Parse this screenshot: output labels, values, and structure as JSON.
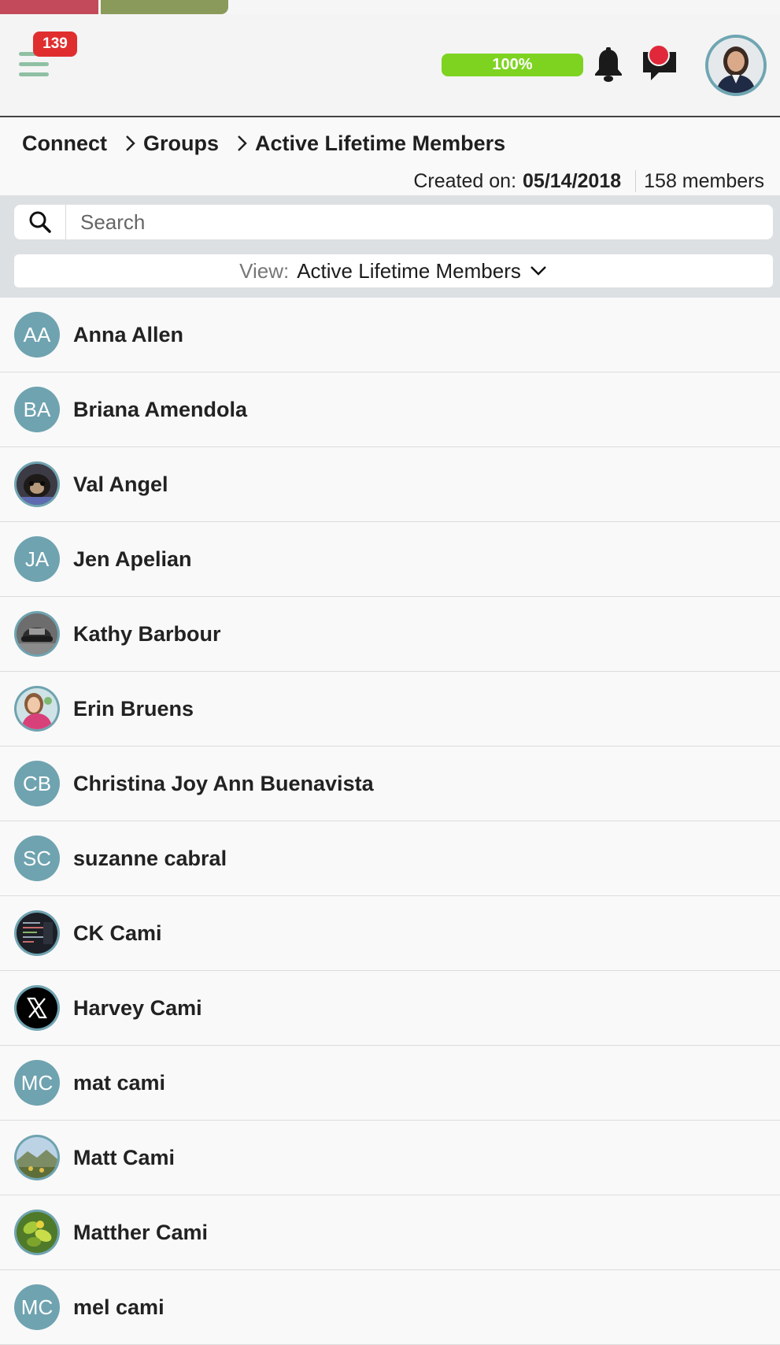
{
  "header": {
    "notification_count": "139",
    "progress_percent": 100,
    "progress_label": "100%"
  },
  "breadcrumb": {
    "items": [
      "Connect",
      "Groups",
      "Active Lifetime Members"
    ]
  },
  "group": {
    "created_label": "Created on:",
    "created_date": "05/14/2018",
    "members_count": "158 members"
  },
  "search": {
    "placeholder": "Search",
    "value": ""
  },
  "view": {
    "label": "View:",
    "selected": "Active Lifetime Members"
  },
  "members": [
    {
      "name": "Anna Allen",
      "initials": "AA",
      "avatar": "initials"
    },
    {
      "name": "Briana Amendola",
      "initials": "BA",
      "avatar": "initials"
    },
    {
      "name": "Val Angel",
      "initials": "",
      "avatar": "photo-dog"
    },
    {
      "name": "Jen Apelian",
      "initials": "JA",
      "avatar": "initials"
    },
    {
      "name": "Kathy Barbour",
      "initials": "",
      "avatar": "photo-cap"
    },
    {
      "name": "Erin Bruens",
      "initials": "",
      "avatar": "photo-girl"
    },
    {
      "name": "Christina Joy Ann Buenavista",
      "initials": "CB",
      "avatar": "initials"
    },
    {
      "name": "suzanne cabral",
      "initials": "SC",
      "avatar": "initials"
    },
    {
      "name": "CK Cami",
      "initials": "",
      "avatar": "photo-code"
    },
    {
      "name": "Harvey Cami",
      "initials": "",
      "avatar": "x-logo"
    },
    {
      "name": "mat cami",
      "initials": "MC",
      "avatar": "initials"
    },
    {
      "name": "Matt Cami",
      "initials": "",
      "avatar": "photo-landscape"
    },
    {
      "name": "Matther Cami",
      "initials": "",
      "avatar": "photo-leaves"
    },
    {
      "name": "mel cami",
      "initials": "MC",
      "avatar": "initials"
    }
  ],
  "colors": {
    "avatar_bg": "#6fa3b0",
    "progress": "#7ed321",
    "badge": "#e02e2e",
    "hamburger": "#8fc0a3"
  }
}
